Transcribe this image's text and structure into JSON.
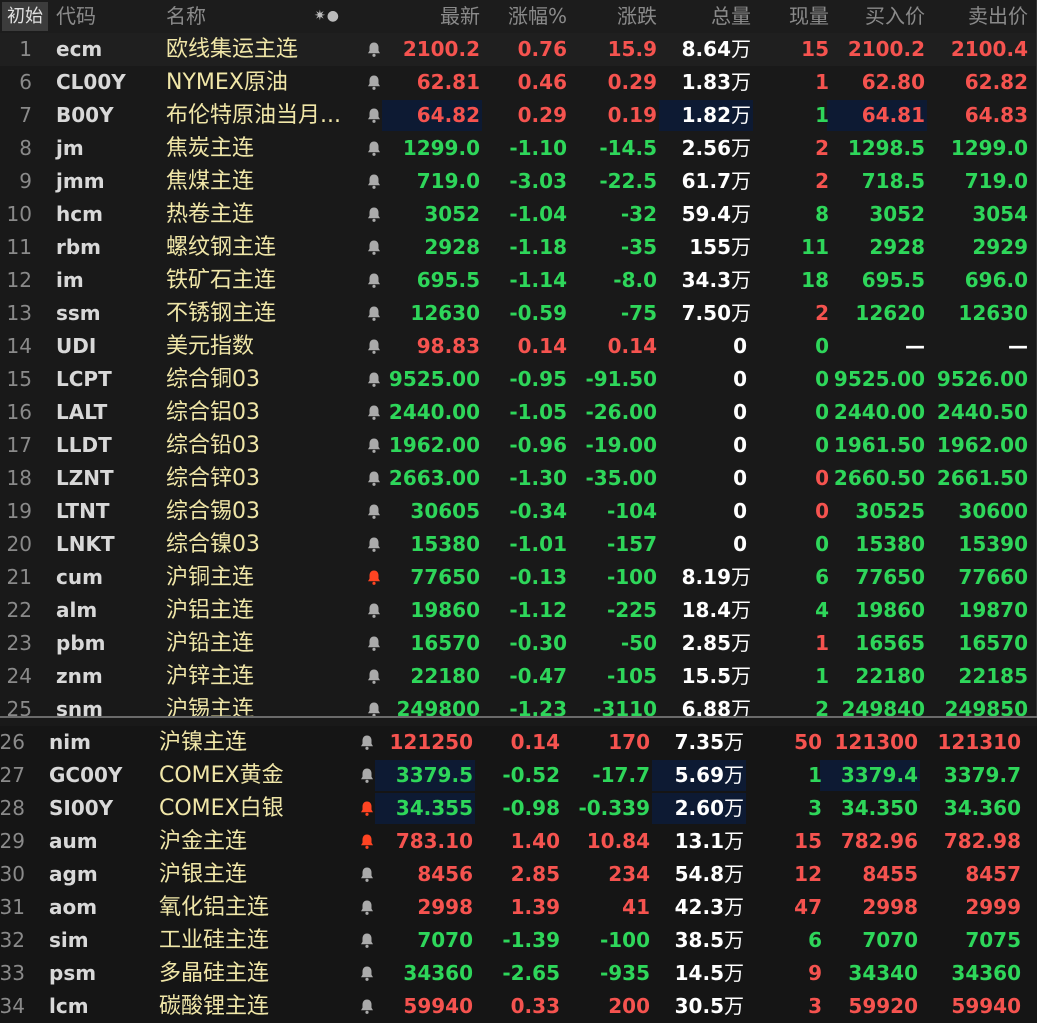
{
  "colors": {
    "up": "#f5534f",
    "down": "#2ed65a",
    "flat": "#ffffff",
    "name": "#f0e6a8",
    "bell_active": "#ff4422",
    "bell": "#aaaaaa"
  },
  "header": {
    "init_label": "初始",
    "code": "代码",
    "name": "名称",
    "symbols": "✷●",
    "latest": "最新",
    "pct": "涨幅%",
    "change": "涨跌",
    "volume": "总量",
    "current": "现量",
    "bid": "买入价",
    "ask": "卖出价"
  },
  "rows": [
    {
      "num": "1",
      "code": "ecm",
      "name": "欧线集运主连",
      "bell": "bell-icon",
      "latest": "2100.2",
      "pct": "0.76",
      "chg": "15.9",
      "vol": "8.64",
      "unit": "万",
      "cur": "15",
      "bid": "2100.2",
      "ask": "2100.4",
      "dir": "up",
      "cur_dir": "up",
      "bid_dir": "up",
      "ask_dir": "up"
    },
    {
      "num": "6",
      "code": "CL00Y",
      "name": "NYMEX原油",
      "bell": "bell-icon",
      "latest": "62.81",
      "pct": "0.46",
      "chg": "0.29",
      "vol": "1.83",
      "unit": "万",
      "cur": "1",
      "bid": "62.80",
      "ask": "62.82",
      "dir": "up",
      "cur_dir": "up",
      "bid_dir": "up",
      "ask_dir": "up"
    },
    {
      "num": "7",
      "code": "B00Y",
      "name": "布伦特原油当月...",
      "bell": "bell-icon",
      "latest": "64.82",
      "pct": "0.29",
      "chg": "0.19",
      "vol": "1.82",
      "unit": "万",
      "cur": "1",
      "bid": "64.81",
      "ask": "64.83",
      "dir": "up",
      "cur_dir": "down",
      "bid_dir": "up",
      "ask_dir": "up"
    },
    {
      "num": "8",
      "code": "jm",
      "name": "焦炭主连",
      "bell": "bell-icon",
      "latest": "1299.0",
      "pct": "-1.10",
      "chg": "-14.5",
      "vol": "2.56",
      "unit": "万",
      "cur": "2",
      "bid": "1298.5",
      "ask": "1299.0",
      "dir": "down",
      "cur_dir": "up",
      "bid_dir": "down",
      "ask_dir": "down"
    },
    {
      "num": "9",
      "code": "jmm",
      "name": "焦煤主连",
      "bell": "bell-icon",
      "latest": "719.0",
      "pct": "-3.03",
      "chg": "-22.5",
      "vol": "61.7",
      "unit": "万",
      "cur": "2",
      "bid": "718.5",
      "ask": "719.0",
      "dir": "down",
      "cur_dir": "up",
      "bid_dir": "down",
      "ask_dir": "down"
    },
    {
      "num": "10",
      "code": "hcm",
      "name": "热卷主连",
      "bell": "bell-icon",
      "latest": "3052",
      "pct": "-1.04",
      "chg": "-32",
      "vol": "59.4",
      "unit": "万",
      "cur": "8",
      "bid": "3052",
      "ask": "3054",
      "dir": "down",
      "cur_dir": "down",
      "bid_dir": "down",
      "ask_dir": "down"
    },
    {
      "num": "11",
      "code": "rbm",
      "name": "螺纹钢主连",
      "bell": "bell-icon",
      "latest": "2928",
      "pct": "-1.18",
      "chg": "-35",
      "vol": "155",
      "unit": "万",
      "cur": "11",
      "bid": "2928",
      "ask": "2929",
      "dir": "down",
      "cur_dir": "down",
      "bid_dir": "down",
      "ask_dir": "down"
    },
    {
      "num": "12",
      "code": "im",
      "name": "铁矿石主连",
      "bell": "bell-icon",
      "latest": "695.5",
      "pct": "-1.14",
      "chg": "-8.0",
      "vol": "34.3",
      "unit": "万",
      "cur": "18",
      "bid": "695.5",
      "ask": "696.0",
      "dir": "down",
      "cur_dir": "down",
      "bid_dir": "down",
      "ask_dir": "down"
    },
    {
      "num": "13",
      "code": "ssm",
      "name": "不锈钢主连",
      "bell": "bell-icon",
      "latest": "12630",
      "pct": "-0.59",
      "chg": "-75",
      "vol": "7.50",
      "unit": "万",
      "cur": "2",
      "bid": "12620",
      "ask": "12630",
      "dir": "down",
      "cur_dir": "up",
      "bid_dir": "down",
      "ask_dir": "down"
    },
    {
      "num": "14",
      "code": "UDI",
      "name": "美元指数",
      "bell": "bell-icon",
      "latest": "98.83",
      "pct": "0.14",
      "chg": "0.14",
      "vol": "0",
      "unit": "",
      "cur": "0",
      "bid": "—",
      "ask": "—",
      "dir": "up",
      "cur_dir": "down",
      "bid_dir": "flat",
      "ask_dir": "flat"
    },
    {
      "num": "15",
      "code": "LCPT",
      "name": "综合铜03",
      "bell": "bell-icon",
      "latest": "9525.00",
      "pct": "-0.95",
      "chg": "-91.50",
      "vol": "0",
      "unit": "",
      "cur": "0",
      "bid": "9525.00",
      "ask": "9526.00",
      "dir": "down",
      "cur_dir": "down",
      "bid_dir": "down",
      "ask_dir": "down"
    },
    {
      "num": "16",
      "code": "LALT",
      "name": "综合铝03",
      "bell": "bell-icon",
      "latest": "2440.00",
      "pct": "-1.05",
      "chg": "-26.00",
      "vol": "0",
      "unit": "",
      "cur": "0",
      "bid": "2440.00",
      "ask": "2440.50",
      "dir": "down",
      "cur_dir": "down",
      "bid_dir": "down",
      "ask_dir": "down"
    },
    {
      "num": "17",
      "code": "LLDT",
      "name": "综合铅03",
      "bell": "bell-icon",
      "latest": "1962.00",
      "pct": "-0.96",
      "chg": "-19.00",
      "vol": "0",
      "unit": "",
      "cur": "0",
      "bid": "1961.50",
      "ask": "1962.00",
      "dir": "down",
      "cur_dir": "down",
      "bid_dir": "down",
      "ask_dir": "down"
    },
    {
      "num": "18",
      "code": "LZNT",
      "name": "综合锌03",
      "bell": "bell-icon",
      "latest": "2663.00",
      "pct": "-1.30",
      "chg": "-35.00",
      "vol": "0",
      "unit": "",
      "cur": "0",
      "bid": "2660.50",
      "ask": "2661.50",
      "dir": "down",
      "cur_dir": "up",
      "bid_dir": "down",
      "ask_dir": "down"
    },
    {
      "num": "19",
      "code": "LTNT",
      "name": "综合锡03",
      "bell": "bell-icon",
      "latest": "30605",
      "pct": "-0.34",
      "chg": "-104",
      "vol": "0",
      "unit": "",
      "cur": "0",
      "bid": "30525",
      "ask": "30600",
      "dir": "down",
      "cur_dir": "up",
      "bid_dir": "down",
      "ask_dir": "down"
    },
    {
      "num": "20",
      "code": "LNKT",
      "name": "综合镍03",
      "bell": "bell-icon",
      "latest": "15380",
      "pct": "-1.01",
      "chg": "-157",
      "vol": "0",
      "unit": "",
      "cur": "0",
      "bid": "15380",
      "ask": "15390",
      "dir": "down",
      "cur_dir": "down",
      "bid_dir": "down",
      "ask_dir": "down"
    },
    {
      "num": "21",
      "code": "cum",
      "name": "沪铜主连",
      "bell": "bell-active-icon",
      "latest": "77650",
      "pct": "-0.13",
      "chg": "-100",
      "vol": "8.19",
      "unit": "万",
      "cur": "6",
      "bid": "77650",
      "ask": "77660",
      "dir": "down",
      "cur_dir": "down",
      "bid_dir": "down",
      "ask_dir": "down"
    },
    {
      "num": "22",
      "code": "alm",
      "name": "沪铝主连",
      "bell": "bell-icon",
      "latest": "19860",
      "pct": "-1.12",
      "chg": "-225",
      "vol": "18.4",
      "unit": "万",
      "cur": "4",
      "bid": "19860",
      "ask": "19870",
      "dir": "down",
      "cur_dir": "down",
      "bid_dir": "down",
      "ask_dir": "down"
    },
    {
      "num": "23",
      "code": "pbm",
      "name": "沪铅主连",
      "bell": "bell-icon",
      "latest": "16570",
      "pct": "-0.30",
      "chg": "-50",
      "vol": "2.85",
      "unit": "万",
      "cur": "1",
      "bid": "16565",
      "ask": "16570",
      "dir": "down",
      "cur_dir": "up",
      "bid_dir": "down",
      "ask_dir": "down"
    },
    {
      "num": "24",
      "code": "znm",
      "name": "沪锌主连",
      "bell": "bell-icon",
      "latest": "22180",
      "pct": "-0.47",
      "chg": "-105",
      "vol": "15.5",
      "unit": "万",
      "cur": "1",
      "bid": "22180",
      "ask": "22185",
      "dir": "down",
      "cur_dir": "down",
      "bid_dir": "down",
      "ask_dir": "down"
    },
    {
      "num": "25",
      "code": "snm",
      "name": "沪锡主连",
      "bell": "bell-icon",
      "latest": "249800",
      "pct": "-1.23",
      "chg": "-3110",
      "vol": "6.88",
      "unit": "万",
      "cur": "2",
      "bid": "249840",
      "ask": "249850",
      "dir": "down",
      "cur_dir": "down",
      "bid_dir": "down",
      "ask_dir": "down"
    },
    {
      "num": "26",
      "code": "nim",
      "name": "沪镍主连",
      "bell": "bell-icon",
      "latest": "121250",
      "pct": "0.14",
      "chg": "170",
      "vol": "7.35",
      "unit": "万",
      "cur": "50",
      "bid": "121300",
      "ask": "121310",
      "dir": "up",
      "cur_dir": "up",
      "bid_dir": "up",
      "ask_dir": "up"
    },
    {
      "num": "27",
      "code": "GC00Y",
      "name": "COMEX黄金",
      "bell": "bell-icon",
      "latest": "3379.5",
      "pct": "-0.52",
      "chg": "-17.7",
      "vol": "5.69",
      "unit": "万",
      "cur": "1",
      "bid": "3379.4",
      "ask": "3379.7",
      "dir": "down",
      "cur_dir": "down",
      "bid_dir": "down",
      "ask_dir": "down"
    },
    {
      "num": "28",
      "code": "SI00Y",
      "name": "COMEX白银",
      "bell": "bell-active-icon",
      "latest": "34.355",
      "pct": "-0.98",
      "chg": "-0.339",
      "vol": "2.60",
      "unit": "万",
      "cur": "3",
      "bid": "34.350",
      "ask": "34.360",
      "dir": "down",
      "cur_dir": "down",
      "bid_dir": "down",
      "ask_dir": "down"
    },
    {
      "num": "29",
      "code": "aum",
      "name": "沪金主连",
      "bell": "bell-active-icon",
      "latest": "783.10",
      "pct": "1.40",
      "chg": "10.84",
      "vol": "13.1",
      "unit": "万",
      "cur": "15",
      "bid": "782.96",
      "ask": "782.98",
      "dir": "up",
      "cur_dir": "up",
      "bid_dir": "up",
      "ask_dir": "up"
    },
    {
      "num": "30",
      "code": "agm",
      "name": "沪银主连",
      "bell": "bell-icon",
      "latest": "8456",
      "pct": "2.85",
      "chg": "234",
      "vol": "54.8",
      "unit": "万",
      "cur": "12",
      "bid": "8455",
      "ask": "8457",
      "dir": "up",
      "cur_dir": "up",
      "bid_dir": "up",
      "ask_dir": "up"
    },
    {
      "num": "31",
      "code": "aom",
      "name": "氧化铝主连",
      "bell": "bell-icon",
      "latest": "2998",
      "pct": "1.39",
      "chg": "41",
      "vol": "42.3",
      "unit": "万",
      "cur": "47",
      "bid": "2998",
      "ask": "2999",
      "dir": "up",
      "cur_dir": "up",
      "bid_dir": "up",
      "ask_dir": "up"
    },
    {
      "num": "32",
      "code": "sim",
      "name": "工业硅主连",
      "bell": "bell-icon",
      "latest": "7070",
      "pct": "-1.39",
      "chg": "-100",
      "vol": "38.5",
      "unit": "万",
      "cur": "6",
      "bid": "7070",
      "ask": "7075",
      "dir": "down",
      "cur_dir": "down",
      "bid_dir": "down",
      "ask_dir": "down"
    },
    {
      "num": "33",
      "code": "psm",
      "name": "多晶硅主连",
      "bell": "bell-icon",
      "latest": "34360",
      "pct": "-2.65",
      "chg": "-935",
      "vol": "14.5",
      "unit": "万",
      "cur": "9",
      "bid": "34340",
      "ask": "34360",
      "dir": "down",
      "cur_dir": "up",
      "bid_dir": "down",
      "ask_dir": "down"
    },
    {
      "num": "34",
      "code": "lcm",
      "name": "碳酸锂主连",
      "bell": "bell-icon",
      "latest": "59940",
      "pct": "0.33",
      "chg": "200",
      "vol": "30.5",
      "unit": "万",
      "cur": "3",
      "bid": "59920",
      "ask": "59940",
      "dir": "up",
      "cur_dir": "up",
      "bid_dir": "up",
      "ask_dir": "up"
    }
  ]
}
